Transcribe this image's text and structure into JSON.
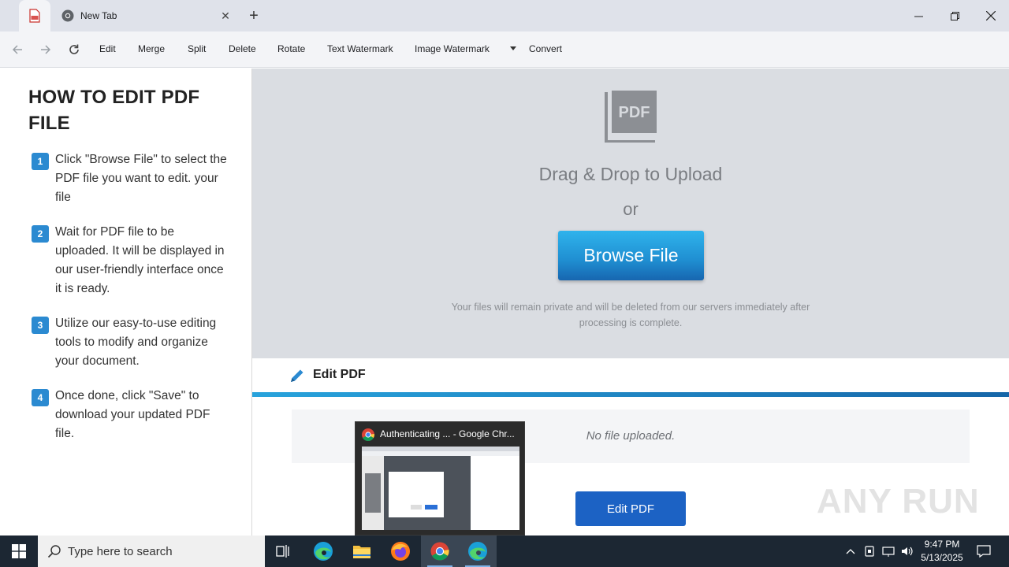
{
  "browser": {
    "tab_title": "New Tab",
    "new_tab": "+"
  },
  "toolbar": {
    "items": [
      "Edit",
      "Merge",
      "Split",
      "Delete",
      "Rotate",
      "Text Watermark",
      "Image Watermark",
      "Convert"
    ]
  },
  "guide": {
    "title": "HOW TO EDIT PDF FILE",
    "steps": [
      {
        "num": "1",
        "text": "Click \"Browse File\" to select the PDF file you want to edit. your file"
      },
      {
        "num": "2",
        "text": "Wait for PDF file to be uploaded. It will be displayed in our user-friendly interface once it is ready."
      },
      {
        "num": "3",
        "text": "Utilize our easy-to-use editing tools to modify and organize your document."
      },
      {
        "num": "4",
        "text": "Once done, click \"Save\" to download your updated PDF file."
      }
    ]
  },
  "upload": {
    "icon_label": "PDF",
    "drag_text": "Drag & Drop to Upload",
    "or_text": "or",
    "browse_label": "Browse File",
    "privacy": "Your files will remain private and will be deleted from our servers immediately after processing is complete."
  },
  "editor": {
    "title": "Edit PDF",
    "empty_text": "No file uploaded.",
    "button_label": "Edit PDF"
  },
  "thumbnail": {
    "title": "Authenticating ... - Google Chr..."
  },
  "watermark": "ANY RUN",
  "taskbar": {
    "search_placeholder": "Type here to search",
    "time": "9:47 PM",
    "date": "5/13/2025"
  },
  "colors": {
    "accent_blue": "#1c62c4",
    "step_badge": "#2b8ad1",
    "upload_bg": "#dadde2"
  }
}
